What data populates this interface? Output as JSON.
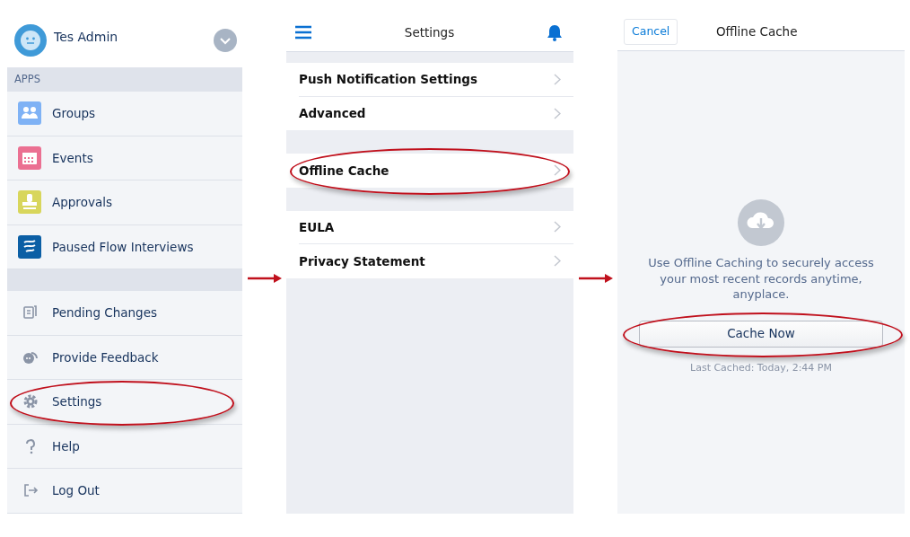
{
  "menu": {
    "user_name": "Tes Admin",
    "apps_header": "APPS",
    "apps": [
      {
        "label": "Groups",
        "kind": "groups",
        "color": "#7fb2f5",
        "highlighted": false
      },
      {
        "label": "Events",
        "kind": "events",
        "color": "#eb7092",
        "highlighted": false
      },
      {
        "label": "Approvals",
        "kind": "approvals",
        "color": "#d8d65c",
        "highlighted": false
      },
      {
        "label": "Paused Flow Interviews",
        "kind": "flow",
        "color": "#0b5fa5",
        "highlighted": false
      }
    ],
    "items": [
      {
        "label": "Pending Changes",
        "kind": "pending",
        "highlighted": false
      },
      {
        "label": "Provide Feedback",
        "kind": "feedback",
        "highlighted": false
      },
      {
        "label": "Settings",
        "kind": "settings",
        "highlighted": true
      },
      {
        "label": "Help",
        "kind": "help",
        "highlighted": false
      },
      {
        "label": "Log Out",
        "kind": "logout",
        "highlighted": false
      }
    ]
  },
  "settings": {
    "title": "Settings",
    "sections": [
      [
        {
          "label": "Push Notification Settings",
          "highlighted": false
        },
        {
          "label": "Advanced",
          "highlighted": false
        }
      ],
      [
        {
          "label": "Offline Cache",
          "highlighted": true
        }
      ],
      [
        {
          "label": "EULA",
          "highlighted": false
        },
        {
          "label": "Privacy Statement",
          "highlighted": false
        }
      ]
    ]
  },
  "offline_cache": {
    "cancel": "Cancel",
    "title": "Offline Cache",
    "message": "Use Offline Caching to securely access your most recent records anytime, anyplace.",
    "button": {
      "label": "Cache Now",
      "highlighted": true
    },
    "last_cached": "Last Cached: Today, 2:44 PM"
  }
}
